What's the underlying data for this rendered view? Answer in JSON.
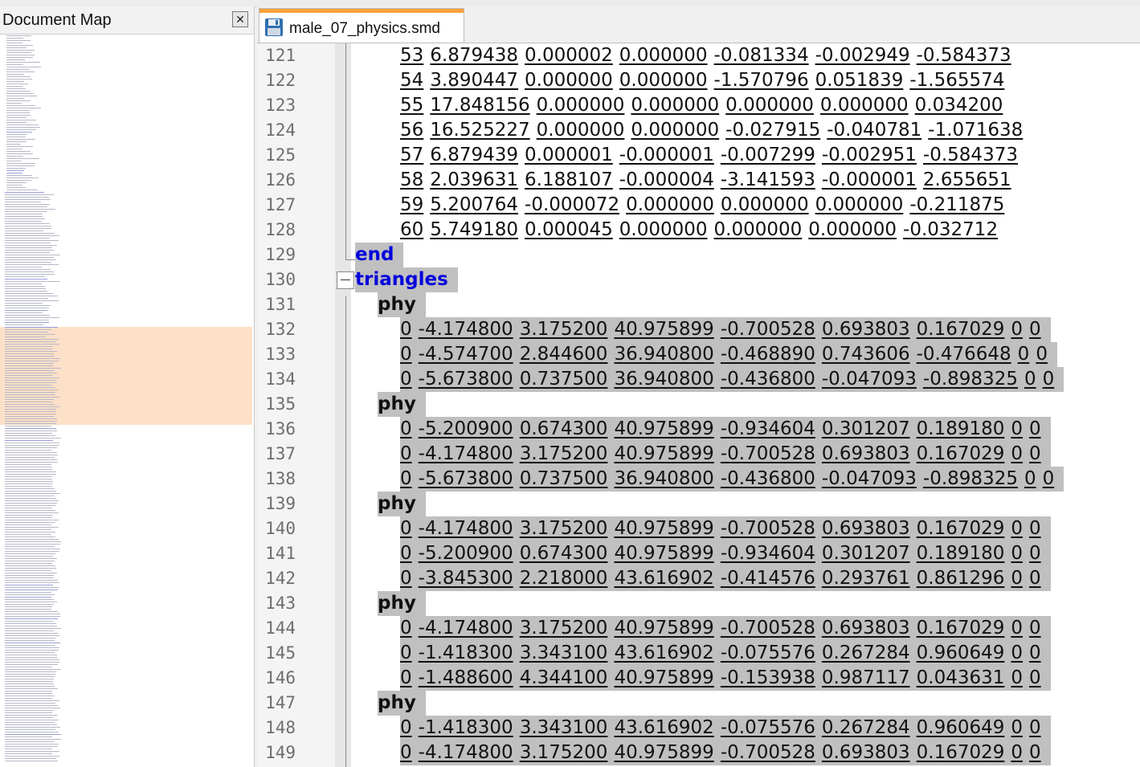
{
  "document_map": {
    "title": "Document Map",
    "close_glyph": "✕"
  },
  "editor": {
    "tab": {
      "filename": "male_07_physics.smd"
    }
  },
  "lines": [
    {
      "n": "121",
      "kind": "bone",
      "tokens": [
        "53",
        "6.879438",
        "0.000002",
        "0.000000",
        "-0.081334",
        "-0.002949",
        "-0.584373"
      ]
    },
    {
      "n": "122",
      "kind": "bone",
      "tokens": [
        "54",
        "3.890447",
        "0.000000",
        "0.000000",
        "-1.570796",
        "0.051839",
        "-1.565574"
      ]
    },
    {
      "n": "123",
      "kind": "bone",
      "tokens": [
        "55",
        "17.848156",
        "0.000000",
        "0.000000",
        "0.000000",
        "0.000000",
        "0.034200"
      ]
    },
    {
      "n": "124",
      "kind": "bone",
      "tokens": [
        "56",
        "16.525227",
        "0.000000",
        "0.000000",
        "-0.027915",
        "-0.040781",
        "-1.071638"
      ]
    },
    {
      "n": "125",
      "kind": "bone",
      "tokens": [
        "57",
        "6.879439",
        "0.000001",
        "-0.000001",
        "-0.007299",
        "-0.002951",
        "-0.584373"
      ]
    },
    {
      "n": "126",
      "kind": "bone",
      "tokens": [
        "58",
        "2.039631",
        "6.188107",
        "-0.000004",
        "-3.141593",
        "-0.000001",
        "2.655651"
      ]
    },
    {
      "n": "127",
      "kind": "bone",
      "tokens": [
        "59",
        "5.200764",
        "-0.000072",
        "0.000000",
        "0.000000",
        "0.000000",
        "-0.211875"
      ]
    },
    {
      "n": "128",
      "kind": "bone",
      "tokens": [
        "60",
        "5.749180",
        "0.000045",
        "0.000000",
        "0.000000",
        "0.000000",
        "-0.032712"
      ]
    },
    {
      "n": "129",
      "kind": "kw",
      "text": "end"
    },
    {
      "n": "130",
      "kind": "kw",
      "text": "triangles"
    },
    {
      "n": "131",
      "kind": "phy",
      "text": "phy"
    },
    {
      "n": "132",
      "kind": "vert",
      "tokens": [
        "0",
        "-4.174800",
        "3.175200",
        "40.975899",
        "-0.700528",
        "0.693803",
        "0.167029",
        "0",
        "0"
      ]
    },
    {
      "n": "133",
      "kind": "vert",
      "tokens": [
        "0",
        "-4.574700",
        "2.844600",
        "36.940800",
        "-0.468890",
        "0.743606",
        "-0.476648",
        "0",
        "0"
      ]
    },
    {
      "n": "134",
      "kind": "vert",
      "tokens": [
        "0",
        "-5.673800",
        "0.737500",
        "36.940800",
        "-0.436800",
        "-0.047093",
        "-0.898325",
        "0",
        "0"
      ]
    },
    {
      "n": "135",
      "kind": "phy",
      "text": "phy"
    },
    {
      "n": "136",
      "kind": "vert",
      "tokens": [
        "0",
        "-5.200900",
        "0.674300",
        "40.975899",
        "-0.934604",
        "0.301207",
        "0.189180",
        "0",
        "0"
      ]
    },
    {
      "n": "137",
      "kind": "vert",
      "tokens": [
        "0",
        "-4.174800",
        "3.175200",
        "40.975899",
        "-0.700528",
        "0.693803",
        "0.167029",
        "0",
        "0"
      ]
    },
    {
      "n": "138",
      "kind": "vert",
      "tokens": [
        "0",
        "-5.673800",
        "0.737500",
        "36.940800",
        "-0.436800",
        "-0.047093",
        "-0.898325",
        "0",
        "0"
      ]
    },
    {
      "n": "139",
      "kind": "phy",
      "text": "phy"
    },
    {
      "n": "140",
      "kind": "vert",
      "tokens": [
        "0",
        "-4.174800",
        "3.175200",
        "40.975899",
        "-0.700528",
        "0.693803",
        "0.167029",
        "0",
        "0"
      ]
    },
    {
      "n": "141",
      "kind": "vert",
      "tokens": [
        "0",
        "-5.200900",
        "0.674300",
        "40.975899",
        "-0.934604",
        "0.301207",
        "0.189180",
        "0",
        "0"
      ]
    },
    {
      "n": "142",
      "kind": "vert",
      "tokens": [
        "0",
        "-3.845300",
        "2.218000",
        "43.616902",
        "-0.414576",
        "0.293761",
        "0.861296",
        "0",
        "0"
      ]
    },
    {
      "n": "143",
      "kind": "phy",
      "text": "phy"
    },
    {
      "n": "144",
      "kind": "vert",
      "tokens": [
        "0",
        "-4.174800",
        "3.175200",
        "40.975899",
        "-0.700528",
        "0.693803",
        "0.167029",
        "0",
        "0"
      ]
    },
    {
      "n": "145",
      "kind": "vert",
      "tokens": [
        "0",
        "-1.418300",
        "3.343100",
        "43.616902",
        "-0.075576",
        "0.267284",
        "0.960649",
        "0",
        "0"
      ]
    },
    {
      "n": "146",
      "kind": "vert",
      "tokens": [
        "0",
        "-1.488600",
        "4.344100",
        "40.975899",
        "-0.153938",
        "0.987117",
        "0.043631",
        "0",
        "0"
      ]
    },
    {
      "n": "147",
      "kind": "phy",
      "text": "phy"
    },
    {
      "n": "148",
      "kind": "vert",
      "tokens": [
        "0",
        "-1.418300",
        "3.343100",
        "43.616902",
        "-0.075576",
        "0.267284",
        "0.960649",
        "0",
        "0"
      ]
    },
    {
      "n": "149",
      "kind": "vert",
      "tokens": [
        "0",
        "-4.174800",
        "3.175200",
        "40.975899",
        "-0.700528",
        "0.693803",
        "0.167029",
        "0",
        "0"
      ]
    }
  ],
  "colors": {
    "keyword": "#0000dd",
    "selection": "#c0c0c0",
    "tab_accent": "#f9a13a",
    "map_highlight": "#fde0c8"
  }
}
